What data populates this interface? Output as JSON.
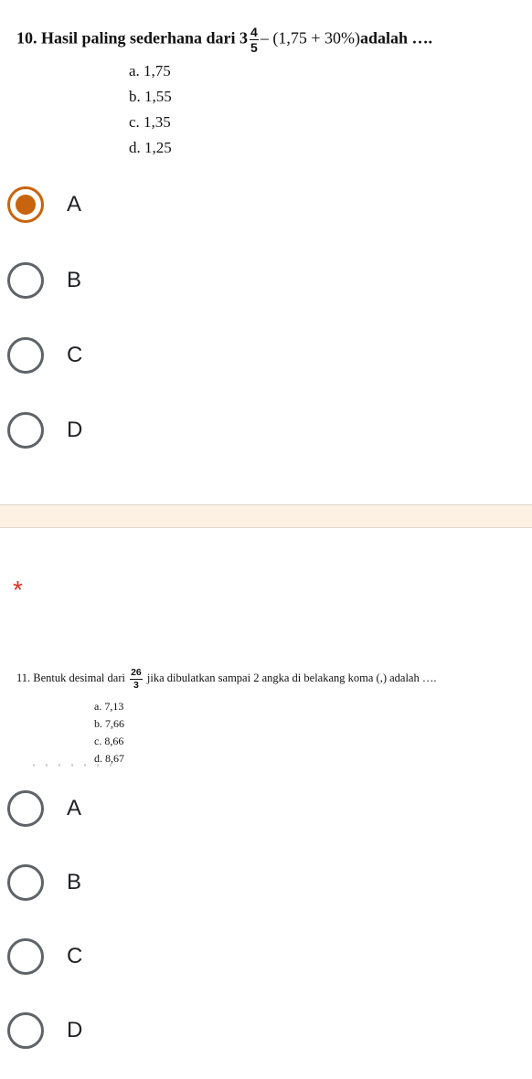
{
  "question10": {
    "stem_prefix": "10. Hasil paling sederhana dari 3",
    "frac_num": "4",
    "frac_den": "5",
    "stem_expr": "– (1,75 + 30%)",
    "stem_suffix": "adalah ….",
    "options": [
      "a.  1,75",
      "b.  1,55",
      "c.  1,35",
      "d.  1,25"
    ],
    "choices": [
      {
        "label": "A",
        "selected": true
      },
      {
        "label": "B",
        "selected": false
      },
      {
        "label": "C",
        "selected": false
      },
      {
        "label": "D",
        "selected": false
      }
    ]
  },
  "section_break": {
    "required_marker": "*"
  },
  "question11": {
    "stem_prefix": "11. Bentuk desimal dari",
    "frac_num": "26",
    "frac_den": "3",
    "stem_suffix": "jika dibulatkan sampai 2 angka di belakang koma (,) adalah ….",
    "options": [
      "a.  7,13",
      "b.  7,66",
      "c.  8,66",
      "d.  8,67"
    ],
    "choices": [
      {
        "label": "A",
        "selected": false
      },
      {
        "label": "B",
        "selected": false
      },
      {
        "label": "C",
        "selected": false
      },
      {
        "label": "D",
        "selected": false
      }
    ]
  },
  "colors": {
    "accent": "#c8640e",
    "radio_border": "#5f6368",
    "required": "#d93025",
    "separator_bg": "#fdf1e4"
  }
}
